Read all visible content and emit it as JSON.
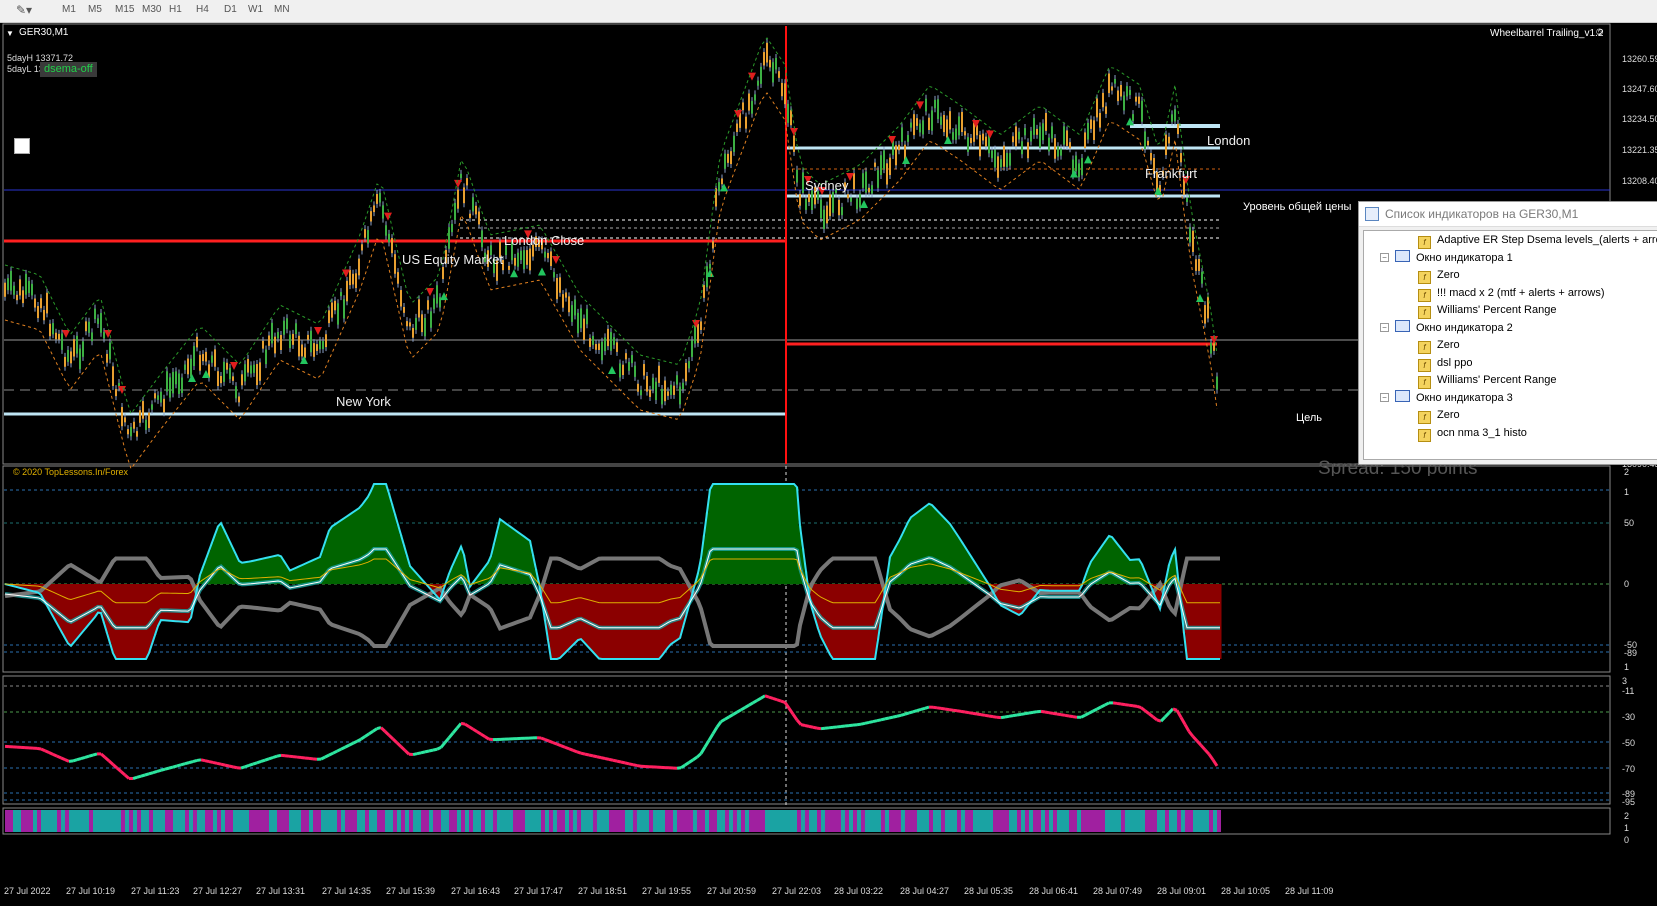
{
  "toolbar": {
    "timeframes": [
      "M1",
      "M5",
      "M15",
      "M30",
      "H1",
      "H4",
      "D1",
      "W1",
      "MN"
    ]
  },
  "chart": {
    "symbol": "GER30,M1",
    "ea_name": "Wheelbarrel Trailing_v1.2",
    "five_day_high": "5dayH 13371.72",
    "five_day_low": "5dayL 13037.1",
    "dsema_badge": "dsema-off",
    "copyright": "© 2020 TopLessons.In/Forex",
    "spread": "Spread: 150 points",
    "sessions": {
      "sydney": "Sydney",
      "london_close": "London Close",
      "us_equity": "US Equity Market",
      "new_york": "New York",
      "frankfurt": "Frankfurt",
      "london": "London"
    },
    "level_label": "Уровень общей цены",
    "target_label": "Цель",
    "price_axis": [
      "13260.59",
      "13247.60",
      "13234.50",
      "13221.35",
      "13208.40",
      "13090.45"
    ],
    "ind1_axis": [
      "2",
      "1",
      "50",
      "0",
      "-50",
      "-89",
      "1"
    ],
    "ind2_axis": [
      "3",
      "-11",
      "-30",
      "-50",
      "-70",
      "-89",
      "-95"
    ],
    "ind3_axis": [
      "2",
      "1",
      "0"
    ],
    "time_axis": [
      "27 Jul 2022",
      "27 Jul 10:19",
      "27 Jul 11:23",
      "27 Jul 12:27",
      "27 Jul 13:31",
      "27 Jul 14:35",
      "27 Jul 15:39",
      "27 Jul 16:43",
      "27 Jul 17:47",
      "27 Jul 18:51",
      "27 Jul 19:55",
      "27 Jul 20:59",
      "27 Jul 22:03",
      "28 Jul 03:22",
      "28 Jul 04:27",
      "28 Jul 05:35",
      "28 Jul 06:41",
      "28 Jul 07:49",
      "28 Jul 09:01",
      "28 Jul 10:05",
      "28 Jul 11:09"
    ]
  },
  "indicator_list": {
    "title": "Список индикаторов на GER30,M1",
    "items": [
      {
        "kind": "ind",
        "label": "Adaptive ER Step Dsema levels_(alerts + arrows)",
        "level": 1
      },
      {
        "kind": "win",
        "label": "Окно индикатора 1",
        "level": 0
      },
      {
        "kind": "ind",
        "label": "Zero",
        "level": 1
      },
      {
        "kind": "ind",
        "label": "!!! macd x 2 (mtf + alerts + arrows)",
        "level": 1
      },
      {
        "kind": "ind",
        "label": "Williams' Percent Range",
        "level": 1
      },
      {
        "kind": "win",
        "label": "Окно индикатора 2",
        "level": 0
      },
      {
        "kind": "ind",
        "label": "Zero",
        "level": 1
      },
      {
        "kind": "ind",
        "label": "dsl ppo",
        "level": 1
      },
      {
        "kind": "ind",
        "label": "Williams' Percent Range",
        "level": 1
      },
      {
        "kind": "win",
        "label": "Окно индикатора 3",
        "level": 0
      },
      {
        "kind": "ind",
        "label": "Zero",
        "level": 1
      },
      {
        "kind": "ind",
        "label": "ocn nma 3_1 histo",
        "level": 1
      }
    ]
  },
  "colors": {
    "bull": "#22c55e",
    "bear": "#e11d1d",
    "macd_pos": "#006400",
    "macd_neg": "#8b0000",
    "teal": "#1aa3a3",
    "magenta": "#a020a0",
    "cyan": "#34e0f0"
  }
}
